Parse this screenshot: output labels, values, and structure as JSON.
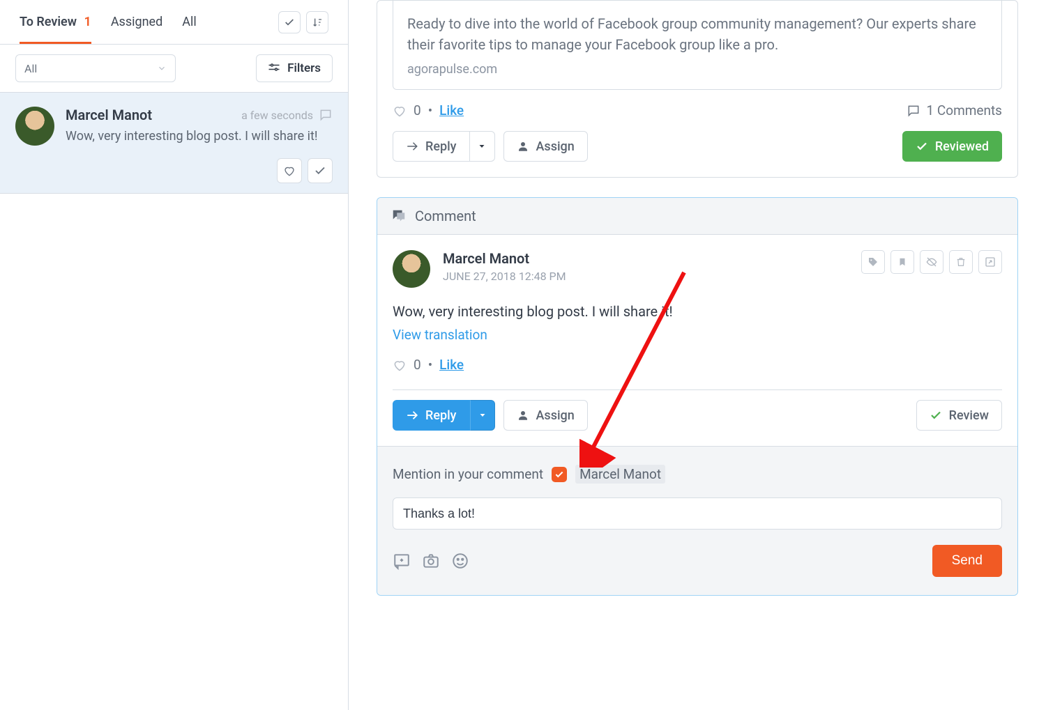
{
  "tabs": {
    "to_review": "To Review",
    "to_review_count": "1",
    "assigned": "Assigned",
    "all": "All"
  },
  "filter": {
    "all": "All",
    "filters": "Filters"
  },
  "list_item": {
    "name": "Marcel Manot",
    "time": "a few seconds",
    "preview": "Wow, very interesting blog post. I will share it!"
  },
  "post": {
    "text": "Ready to dive into the world of Facebook group community management? Our experts share their favorite tips to manage your Facebook group like a pro.",
    "domain": "agorapulse.com",
    "likes": "0",
    "like_label": "Like",
    "comments": "1 Comments",
    "reply": "Reply",
    "assign": "Assign",
    "reviewed": "Reviewed"
  },
  "comment": {
    "header": "Comment",
    "name": "Marcel Manot",
    "date": "JUNE 27, 2018 12:48 PM",
    "text": "Wow, very interesting blog post. I will share it!",
    "translate": "View translation",
    "likes": "0",
    "like_label": "Like",
    "reply": "Reply",
    "assign": "Assign",
    "review": "Review",
    "mention_label": "Mention in your comment",
    "mention_name": "Marcel Manot",
    "input_value": "Thanks a lot!",
    "send": "Send"
  }
}
